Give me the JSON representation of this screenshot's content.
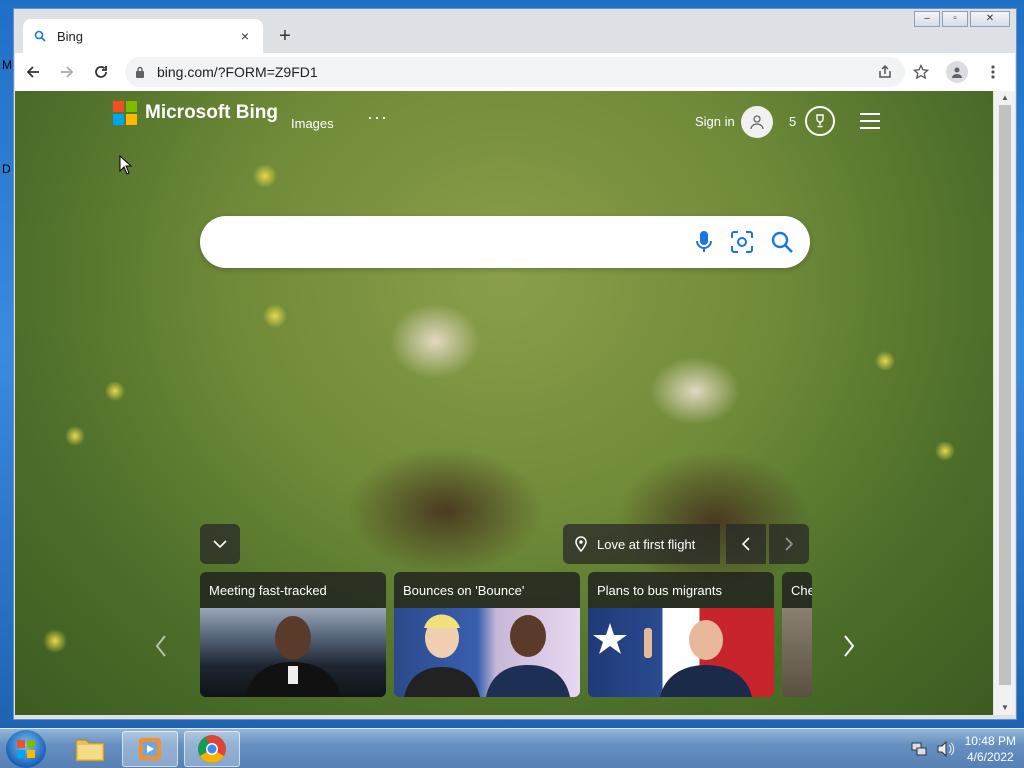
{
  "desktop": {
    "letters": [
      "M",
      "D"
    ]
  },
  "window": {
    "controls": {
      "minimize": "–",
      "maximize": "▫",
      "close": "✕"
    }
  },
  "tab": {
    "title": "Bing",
    "close": "×",
    "new_tab": "+"
  },
  "toolbar": {
    "url": "bing.com/?FORM=Z9FD1"
  },
  "bing": {
    "brand": "Microsoft Bing",
    "nav_images": "Images",
    "nav_more": "···",
    "sign_in": "Sign in",
    "rewards_count": "5",
    "search_placeholder": "",
    "logo_colors": [
      "#f25022",
      "#7fba00",
      "#00a4ef",
      "#ffb900"
    ]
  },
  "caption": {
    "text": "Love at first flight"
  },
  "cards": [
    {
      "title": "Meeting fast-tracked"
    },
    {
      "title": "Bounces on 'Bounce'"
    },
    {
      "title": "Plans to bus migrants"
    },
    {
      "title": "Che"
    }
  ],
  "taskbar": {
    "apps": [
      "windows-explorer",
      "media-player",
      "google-chrome"
    ],
    "time": "10:48 PM",
    "date": "4/6/2022"
  }
}
